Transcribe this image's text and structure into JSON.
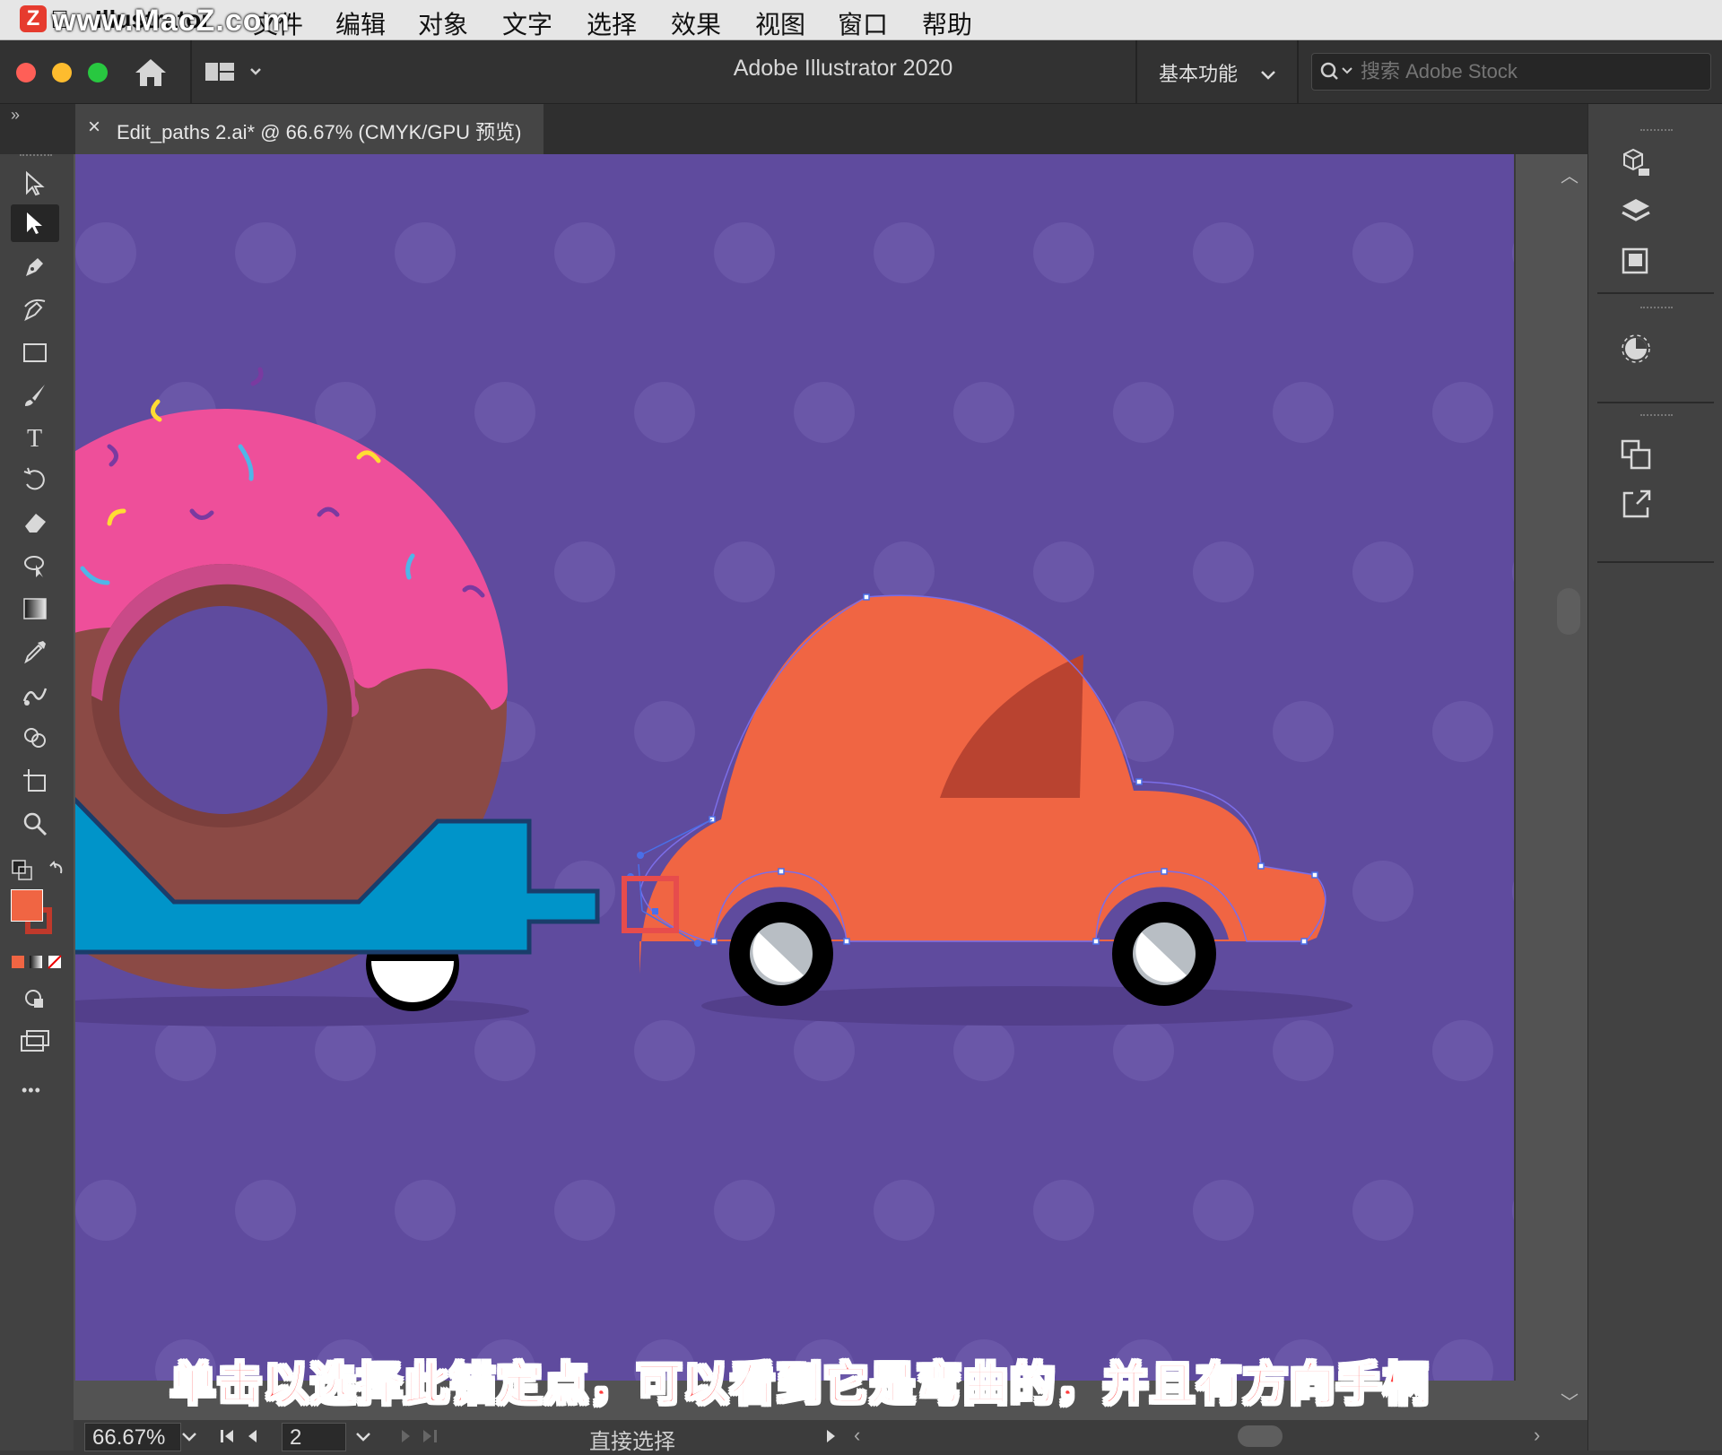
{
  "menubar": {
    "watermark": "www.MacZ.com",
    "watermark_logo": "Z",
    "app_menu": "Illustrator",
    "items": [
      "文件",
      "编辑",
      "对象",
      "文字",
      "选择",
      "效果",
      "视图",
      "窗口",
      "帮助"
    ]
  },
  "titlebar": {
    "title": "Adobe Illustrator 2020",
    "workspace": "基本功能",
    "stock_placeholder": "搜索 Adobe Stock"
  },
  "document": {
    "tab_title": "Edit_paths 2.ai* @ 66.67% (CMYK/GPU 预览)",
    "close_label": "×"
  },
  "statusbar": {
    "zoom": "66.67%",
    "page": "2",
    "tool_name": "直接选择"
  },
  "subtitle": "单击以选择此锚定点，可以看到它是弯曲的，并且有方向手柄",
  "toolbar": {
    "icons": [
      "selection-tool-icon",
      "direct-selection-tool-icon",
      "pen-tool-icon",
      "curvature-tool-icon",
      "rectangle-tool-icon",
      "paintbrush-tool-icon",
      "type-tool-icon",
      "rotate-tool-icon",
      "eraser-tool-icon",
      "free-transform-tool-icon",
      "gradient-tool-icon",
      "eyedropper-tool-icon",
      "blend-tool-icon",
      "shape-builder-tool-icon",
      "artboard-tool-icon",
      "zoom-tool-icon"
    ],
    "active": "direct-selection-tool-icon",
    "fill_color": "#f06543",
    "stroke_color": "#c0392b",
    "more_label": "•••"
  },
  "artwork": {
    "background": "#5f4b9e",
    "car_color": "#f06543",
    "car_window_color": "#b94330",
    "donut_pink": "#ee4f9a",
    "donut_brown": "#8b4a45",
    "trailer_blue": "#0094c9"
  }
}
